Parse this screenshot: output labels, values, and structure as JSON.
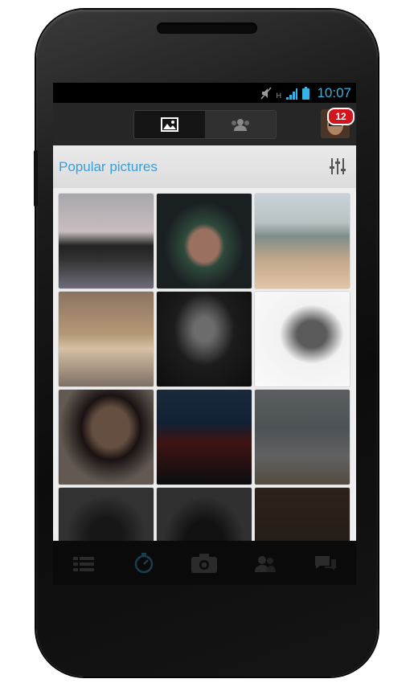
{
  "status": {
    "time": "10:07",
    "network": "H"
  },
  "actionbar": {
    "tabs": [
      {
        "name": "pictures",
        "icon": "image-icon"
      },
      {
        "name": "people",
        "icon": "people-icon"
      }
    ],
    "notification_count": "12"
  },
  "section": {
    "title": "Popular pictures"
  },
  "bottom_nav": [
    "list-icon",
    "timer-icon",
    "camera-icon",
    "people-icon",
    "chat-icon"
  ],
  "colors": {
    "accent": "#33b5e5",
    "title": "#3a9fd6",
    "badge": "#d0161c"
  }
}
